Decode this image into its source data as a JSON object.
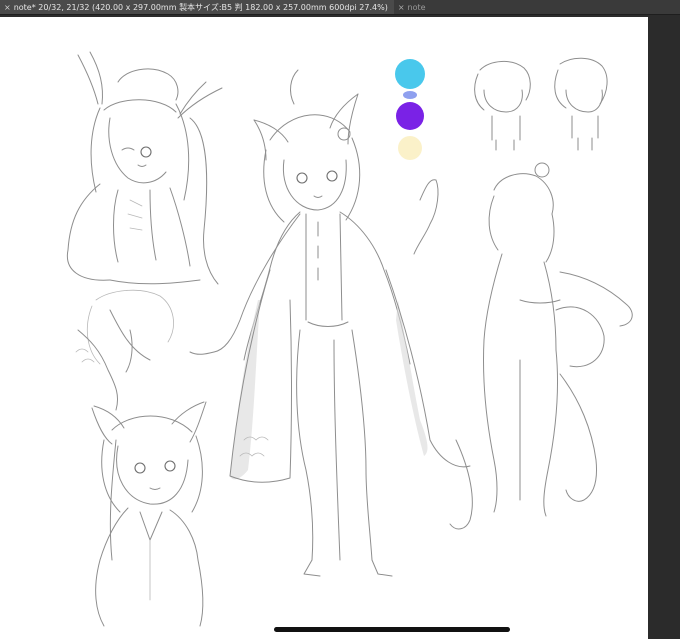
{
  "window": {
    "tabs": [
      {
        "label": "note* 20/32, 21/32 (420.00 x 297.00mm 製本サイズ:B5 判 182.00 x 257.00mm 600dpi 27.4%)",
        "active": true
      },
      {
        "label": "note",
        "active": false
      }
    ]
  },
  "palette": {
    "swatches": [
      "#49c8ec",
      "#8fa0ef",
      "#7a22e6",
      "#fbf1c9"
    ]
  },
  "icons": {
    "close": "close-icon"
  }
}
